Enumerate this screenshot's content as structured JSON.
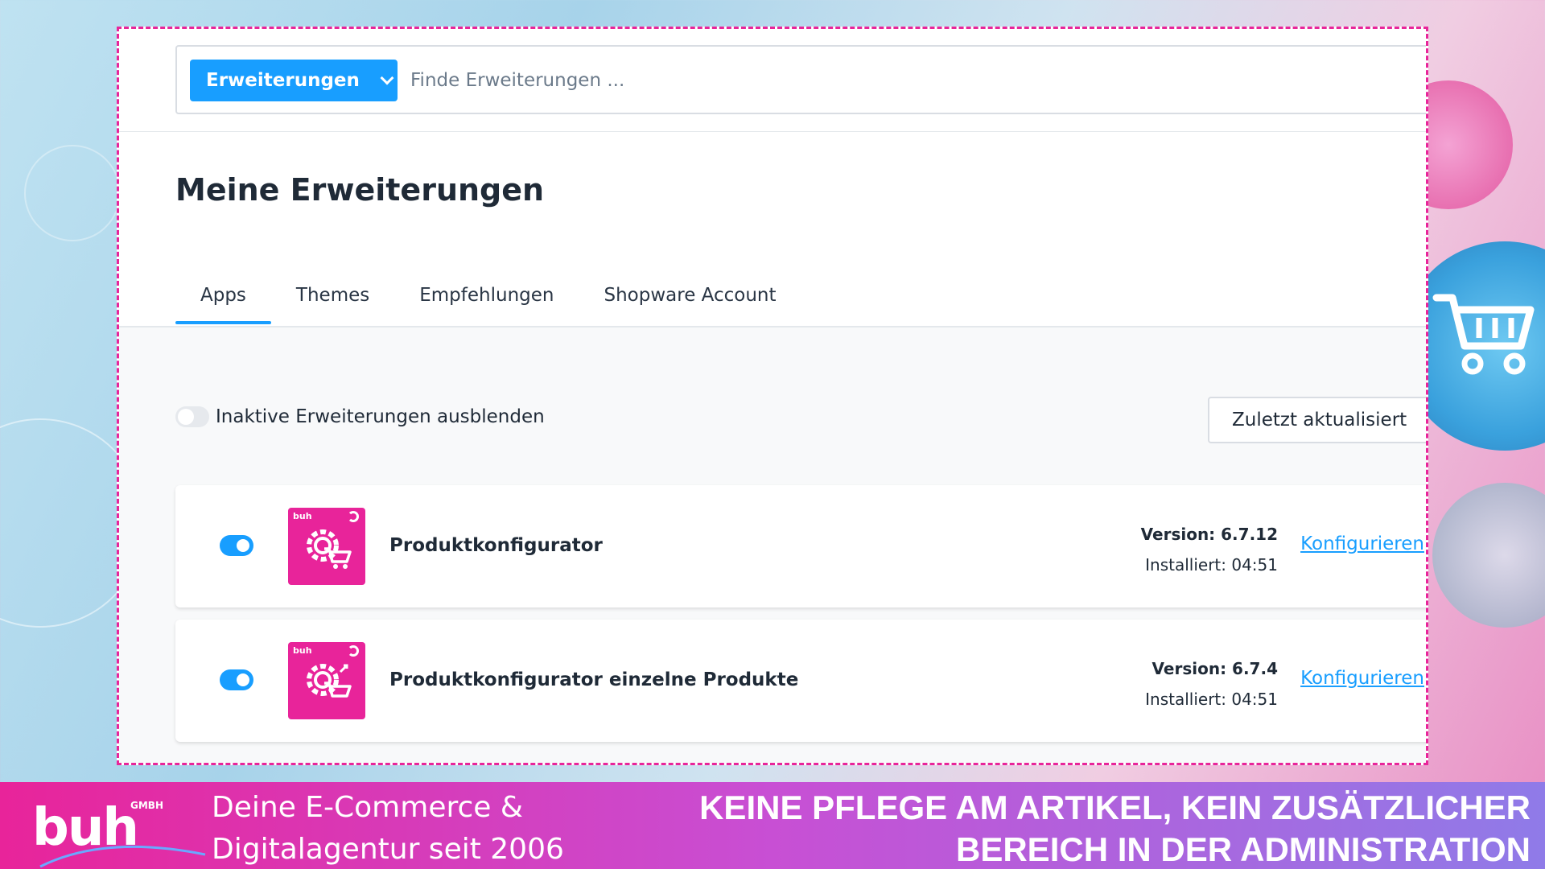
{
  "search": {
    "dropdown_label": "Erweiterungen",
    "placeholder": "Finde Erweiterungen ..."
  },
  "page": {
    "title": "Meine Erweiterungen"
  },
  "tabs": [
    {
      "label": "Apps",
      "active": true
    },
    {
      "label": "Themes",
      "active": false
    },
    {
      "label": "Empfehlungen",
      "active": false
    },
    {
      "label": "Shopware Account",
      "active": false
    }
  ],
  "filters": {
    "hide_inactive_label": "Inaktive Erweiterungen ausblenden",
    "sort_label": "Zuletzt aktualisiert"
  },
  "extensions": [
    {
      "name": "Produktkonfigurator",
      "version": "Version: 6.7.12",
      "installed": "Installiert: 04:51",
      "action": "Konfigurieren",
      "active": true,
      "logo_text": "buh"
    },
    {
      "name": "Produktkonfigurator einzelne Produkte",
      "version": "Version: 6.7.4",
      "installed": "Installiert: 04:51",
      "action": "Konfigurieren",
      "active": true,
      "logo_text": "buh"
    }
  ],
  "footer": {
    "brand": "buh",
    "brand_suffix": "GMBH",
    "tagline_line1": "Deine E-Commerce &",
    "tagline_line2": "Digitalagentur seit 2006",
    "headline_line1": "KEINE PFLEGE AM ARTIKEL, KEIN ZUSÄTZLICHER",
    "headline_line2": "BEREICH IN DER ADMINISTRATION"
  },
  "colors": {
    "accent": "#189eff",
    "brand_pink": "#e8249a",
    "dashed_frame": "#e8259a"
  }
}
